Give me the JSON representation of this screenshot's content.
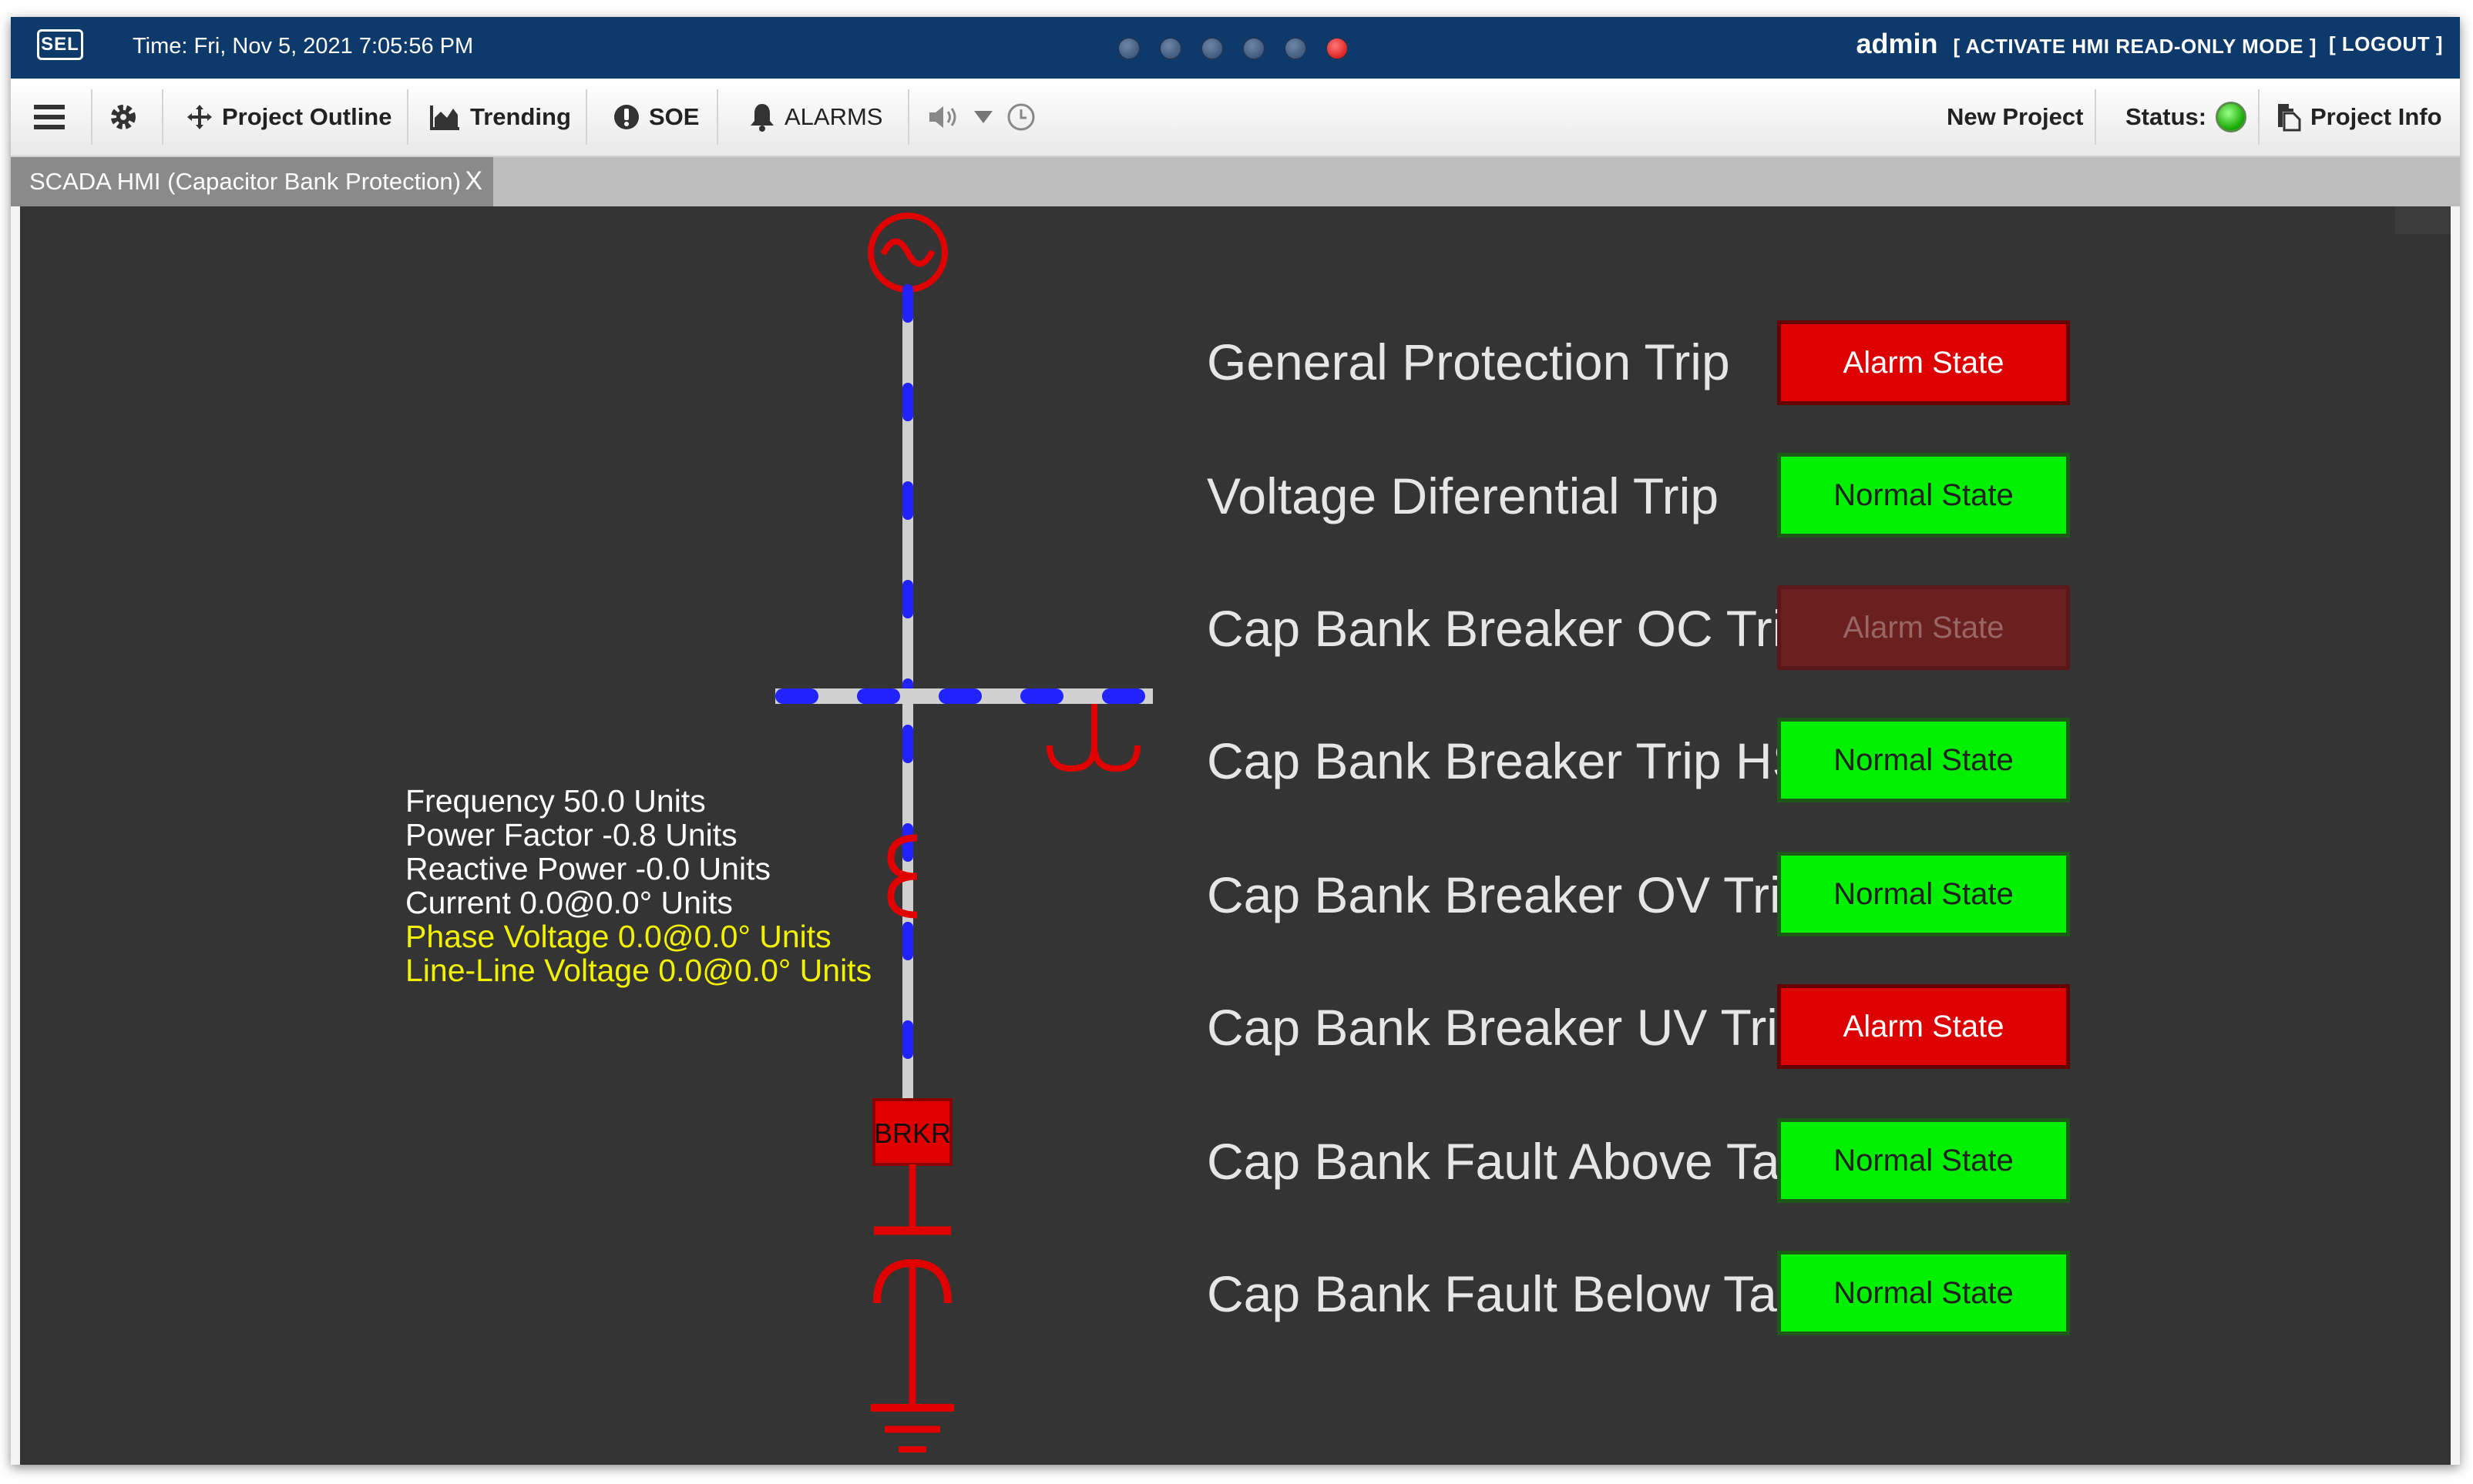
{
  "topbar": {
    "logo_text": "SEL",
    "time": "Time: Fri, Nov 5, 2021 7:05:56 PM",
    "user": "admin",
    "hmi_mode": "[ ACTIVATE HMI READ-ONLY MODE ]",
    "logout": "[ LOGOUT ]",
    "page_dots": 6,
    "active_dot": 6
  },
  "toolbar": {
    "project_outline": "Project Outline",
    "trending": "Trending",
    "soe": "SOE",
    "alarms": "ALARMS",
    "new_project": "New Project",
    "status_label": "Status:",
    "status_color": "#14a900",
    "project_info": "Project Info"
  },
  "tab": {
    "title": "SCADA HMI (Capacitor Bank Protection)",
    "close": "X"
  },
  "diagram": {
    "breaker_label": "BRKR",
    "line_color": "#d0d0d0",
    "flow_color": "#2222ff",
    "symbol_color": "#e00000"
  },
  "measurements": {
    "frequency": "Frequency  50.0  Units",
    "power_factor": "Power Factor  -0.8  Units",
    "reactive_power": "Reactive Power  -0.0  Units",
    "current": "Current  0.0@0.0°  Units",
    "phase_voltage": "Phase Voltage  0.0@0.0°  Units",
    "line_line_voltage": "Line-Line Voltage  0.0@0.0°  Units"
  },
  "indicators": [
    {
      "label": "General Protection Trip",
      "state": "Alarm State",
      "style": "alarm"
    },
    {
      "label": "Voltage Diferential Trip",
      "state": "Normal State",
      "style": "normal"
    },
    {
      "label": "Cap Bank Breaker OC Trip",
      "state": "Alarm State",
      "style": "alarm-dim"
    },
    {
      "label": "Cap Bank Breaker Trip HS",
      "state": "Normal State",
      "style": "normal"
    },
    {
      "label": "Cap Bank Breaker OV Trip",
      "state": "Normal State",
      "style": "normal"
    },
    {
      "label": "Cap Bank Breaker UV Trip",
      "state": "Alarm State",
      "style": "alarm"
    },
    {
      "label": "Cap Bank Fault Above Tap",
      "state": "Normal State",
      "style": "normal"
    },
    {
      "label": "Cap Bank Fault Below Tap",
      "state": "Normal State",
      "style": "normal"
    }
  ]
}
